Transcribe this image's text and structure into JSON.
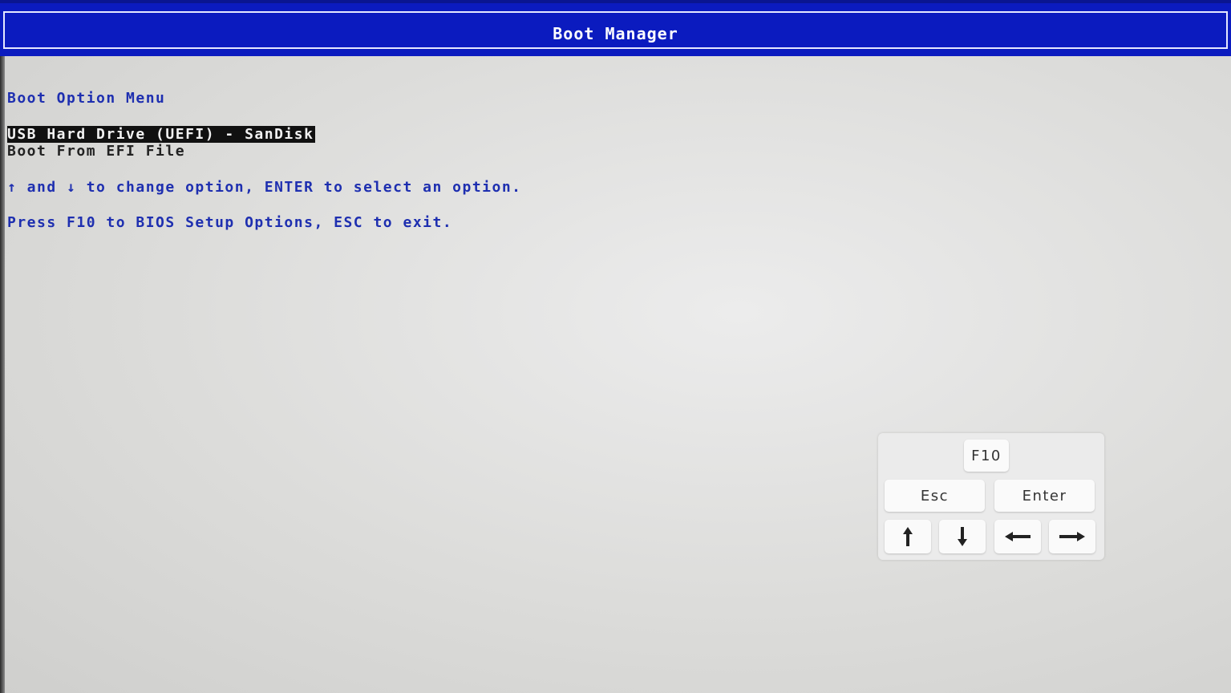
{
  "header": {
    "title": "Boot Manager"
  },
  "menu": {
    "heading": "Boot Option Menu",
    "options": [
      {
        "label": "USB Hard Drive (UEFI) - SanDisk",
        "selected": true
      },
      {
        "label": "Boot From EFI File",
        "selected": false
      }
    ]
  },
  "help": {
    "navigation": "↑ and ↓ to change option, ENTER to select an option.",
    "setup": "Press F10 to BIOS Setup Options, ESC to exit."
  },
  "keypad": {
    "f10_label": "F10",
    "esc_label": "Esc",
    "enter_label": "Enter",
    "up_icon": "arrow-up-icon",
    "down_icon": "arrow-down-icon",
    "left_icon": "arrow-left-icon",
    "right_icon": "arrow-right-icon"
  },
  "colors": {
    "title_bar": "#0b1bbf",
    "text_blue": "#1e2fb0",
    "selection_bg": "#111111",
    "background": "#dcdcda"
  }
}
